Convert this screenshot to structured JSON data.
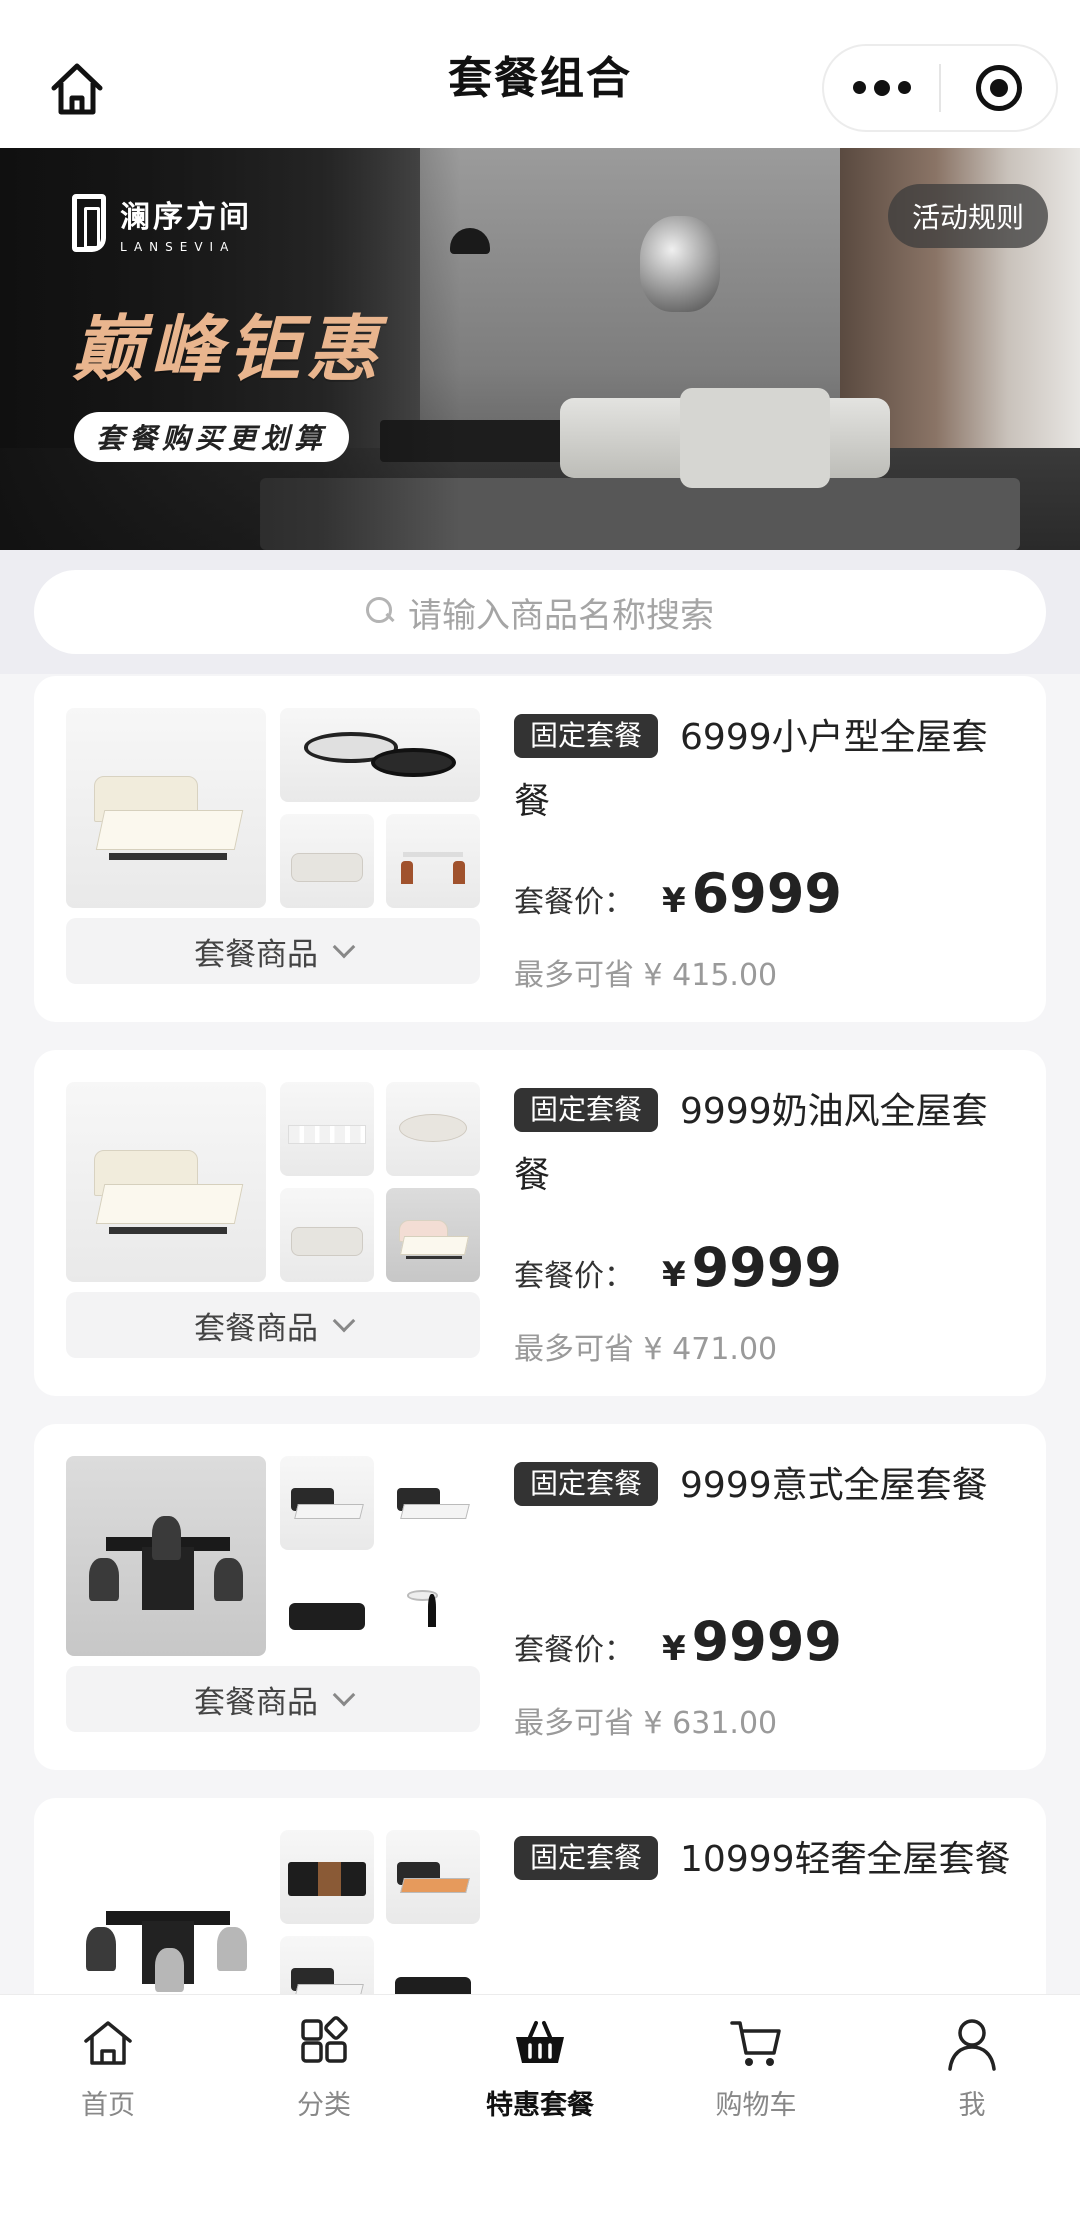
{
  "nav": {
    "title": "套餐组合"
  },
  "banner": {
    "brand_name": "澜序方间",
    "brand_sub": "LANSEVIA",
    "promo_title": "巅峰钜惠",
    "promo_sub": "套餐购买更划算",
    "rules_label": "活动规则"
  },
  "search": {
    "placeholder": "请输入商品名称搜索"
  },
  "packages": [
    {
      "tag": "固定套餐",
      "name": "6999小户型全屋套餐",
      "price_label": "套餐价：",
      "currency": "¥",
      "price": "6999",
      "save": "最多可省 ¥ 415.00",
      "toggle": "套餐商品"
    },
    {
      "tag": "固定套餐",
      "name": "9999奶油风全屋套餐",
      "price_label": "套餐价：",
      "currency": "¥",
      "price": "9999",
      "save": "最多可省 ¥ 471.00",
      "toggle": "套餐商品"
    },
    {
      "tag": "固定套餐",
      "name": "9999意式全屋套餐",
      "price_label": "套餐价：",
      "currency": "¥",
      "price": "9999",
      "save": "最多可省 ¥ 631.00",
      "toggle": "套餐商品"
    },
    {
      "tag": "固定套餐",
      "name": "10999轻奢全屋套餐"
    }
  ],
  "tabs": [
    {
      "label": "首页",
      "icon": "home-icon"
    },
    {
      "label": "分类",
      "icon": "category-icon"
    },
    {
      "label": "特惠套餐",
      "icon": "basket-icon",
      "active": true
    },
    {
      "label": "购物车",
      "icon": "cart-icon"
    },
    {
      "label": "我",
      "icon": "user-icon"
    }
  ]
}
